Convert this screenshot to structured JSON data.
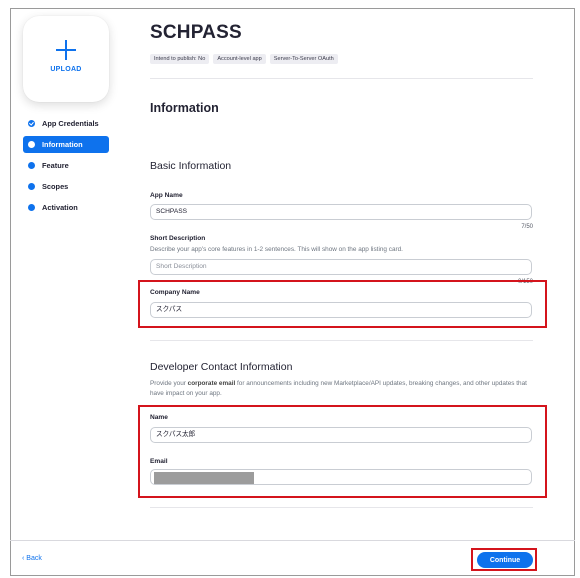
{
  "colors": {
    "accent": "#0e72ed",
    "highlight": "#d4141c",
    "text": "#232333"
  },
  "upload": {
    "label": "UPLOAD",
    "icon": "plus-icon"
  },
  "sidebar": {
    "items": [
      {
        "label": "App Credentials",
        "state": "done"
      },
      {
        "label": "Information",
        "state": "active"
      },
      {
        "label": "Feature",
        "state": "pending"
      },
      {
        "label": "Scopes",
        "state": "pending"
      },
      {
        "label": "Activation",
        "state": "pending"
      }
    ]
  },
  "header": {
    "app_title": "SCHPASS",
    "tags": [
      "Intend to publish: No",
      "Account-level app",
      "Server-To-Server OAuth"
    ]
  },
  "information": {
    "title": "Information",
    "basic": {
      "title": "Basic Information",
      "app_name": {
        "label": "App Name",
        "value": "SCHPASS",
        "counter": "7/50"
      },
      "short_description": {
        "label": "Short Description",
        "hint": "Describe your app's core features in 1-2 sentences. This will show on the app listing card.",
        "placeholder": "Short Description",
        "counter": "0/150"
      },
      "company_name": {
        "label": "Company Name",
        "value": "スクパス"
      }
    },
    "developer": {
      "title": "Developer Contact Information",
      "hint_pre": "Provide your ",
      "hint_bold": "corporate email",
      "hint_post": " for announcements including new Marketplace/API updates, breaking changes, and other updates that have impact on your app.",
      "name": {
        "label": "Name",
        "value": "スクパス太郎"
      },
      "email": {
        "label": "Email",
        "value": ""
      }
    }
  },
  "footer": {
    "back_label": "Back",
    "back_icon": "chevron-left-icon",
    "continue_label": "Continue"
  }
}
